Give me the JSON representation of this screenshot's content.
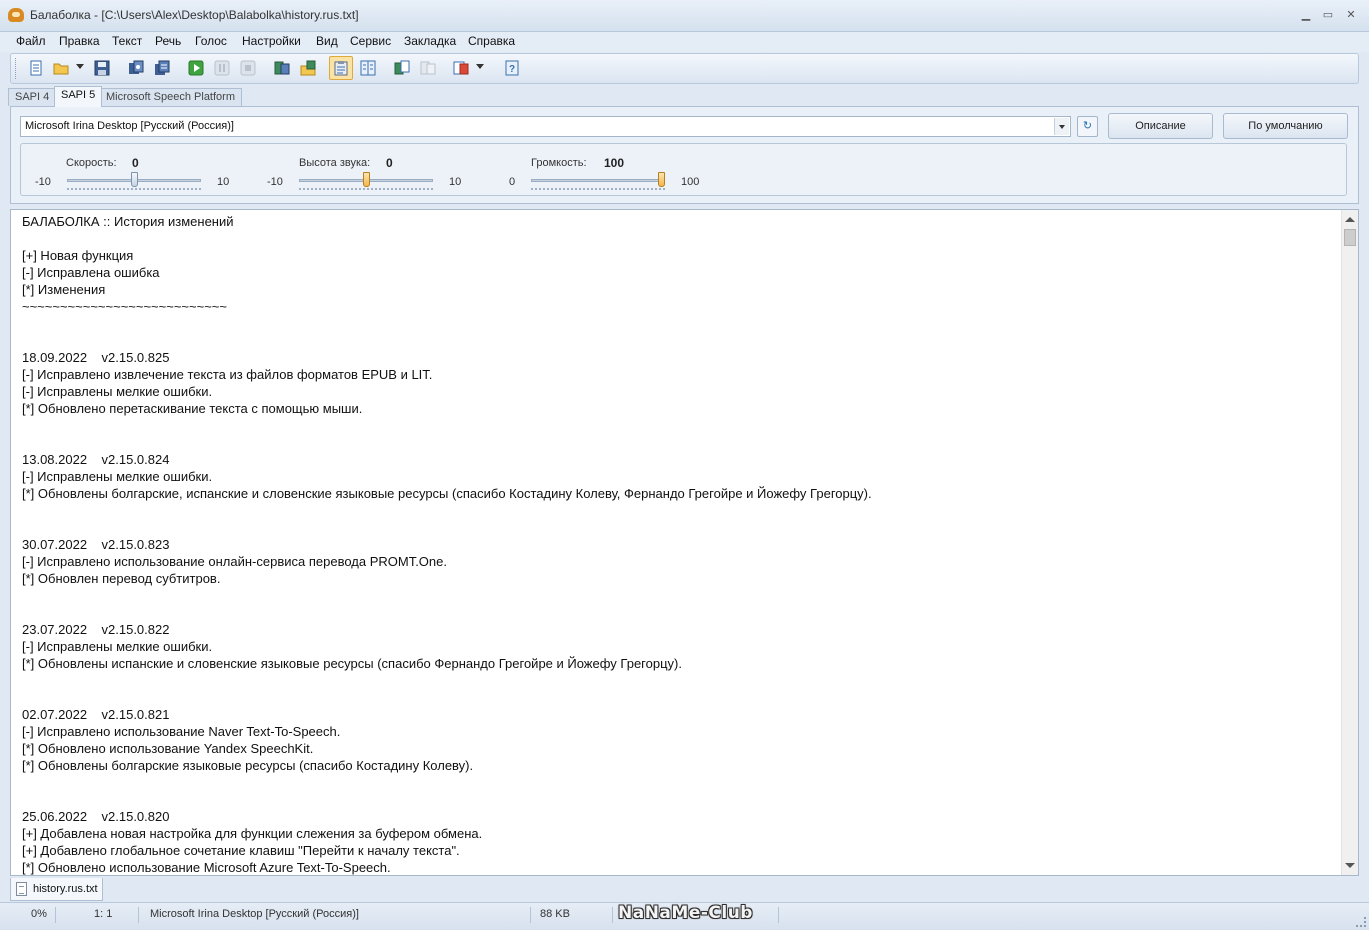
{
  "window": {
    "title": "Балаболка - [C:\\Users\\Alex\\Desktop\\Balabolka\\history.rus.txt]",
    "minimize": "▁",
    "maximize": "▭",
    "close": "✕"
  },
  "menu": [
    "Файл",
    "Правка",
    "Текст",
    "Речь",
    "Голос",
    "Настройки",
    "Вид",
    "Сервис",
    "Закладка",
    "Справка"
  ],
  "toolbar": {
    "icons": [
      "new-file-icon",
      "open-folder-icon",
      "save-icon",
      "save-audio-icon",
      "batch-convert-icon",
      "play-icon",
      "pause-icon",
      "stop-icon",
      "read-clipboard-icon",
      "read-file-icon",
      "watch-clipboard-icon",
      "split-file-icon",
      "text-extract-icon",
      "compare-icon",
      "help-icon"
    ]
  },
  "voice_tabs": [
    "SAPI 4",
    "SAPI 5",
    "Microsoft Speech Platform"
  ],
  "voice_tab_selected": "SAPI 5",
  "voice": {
    "selected": "Microsoft Irina Desktop [Русский (Россия)]",
    "refresh": "↻",
    "describe_label": "Описание",
    "default_label": "По умолчанию"
  },
  "sliders": {
    "rate": {
      "label": "Скорость:",
      "value": "0",
      "min": "-10",
      "max": "10",
      "level": 0.5
    },
    "pitch": {
      "label": "Высота звука:",
      "value": "0",
      "min": "-10",
      "max": "10",
      "level": 0.5
    },
    "volume": {
      "label": "Громкость:",
      "value": "100",
      "min": "0",
      "max": "100",
      "level": 1.0
    }
  },
  "document": {
    "lines": [
      "БАЛАБОЛКА :: История изменений",
      "",
      "[+] Новая функция",
      "[-] Исправлена ошибка",
      "[*] Изменения",
      "~~~~~~~~~~~~~~~~~~~~~~~~~~~",
      "",
      "",
      "18.09.2022    v2.15.0.825",
      "[-] Исправлено извлечение текста из файлов форматов EPUB и LIT.",
      "[-] Исправлены мелкие ошибки.",
      "[*] Обновлено перетаскивание текста с помощью мыши.",
      "",
      "",
      "13.08.2022    v2.15.0.824",
      "[-] Исправлены мелкие ошибки.",
      "[*] Обновлены болгарские, испанские и словенские языковые ресурсы (спасибо Костадину Колеву, Фернандо Грегойре и Йожефу Грегорцу).",
      "",
      "",
      "30.07.2022    v2.15.0.823",
      "[-] Исправлено использование онлайн-сервиса перевода PROMT.One.",
      "[*] Обновлен перевод субтитров.",
      "",
      "",
      "23.07.2022    v2.15.0.822",
      "[-] Исправлены мелкие ошибки.",
      "[*] Обновлены испанские и словенские языковые ресурсы (спасибо Фернандо Грегойре и Йожефу Грегорцу).",
      "",
      "",
      "02.07.2022    v2.15.0.821",
      "[-] Исправлено использование Naver Text-To-Speech.",
      "[*] Обновлено использование Yandex SpeechKit.",
      "[*] Обновлены болгарские языковые ресурсы (спасибо Костадину Колеву).",
      "",
      "",
      "25.06.2022    v2.15.0.820",
      "[+] Добавлена новая настройка для функции слежения за буфером обмена.",
      "[+] Добавлено глобальное сочетание клавиш \"Перейти к началу текста\".",
      "[*] Обновлено использование Microsoft Azure Text-To-Speech."
    ]
  },
  "doc_tab": "history.rus.txt",
  "status": {
    "progress": "0%",
    "position": "1:  1",
    "voice": "Microsoft Irina Desktop [Русский (Россия)]",
    "size": "88 KB",
    "watermark": "NaNaMe-Club"
  }
}
